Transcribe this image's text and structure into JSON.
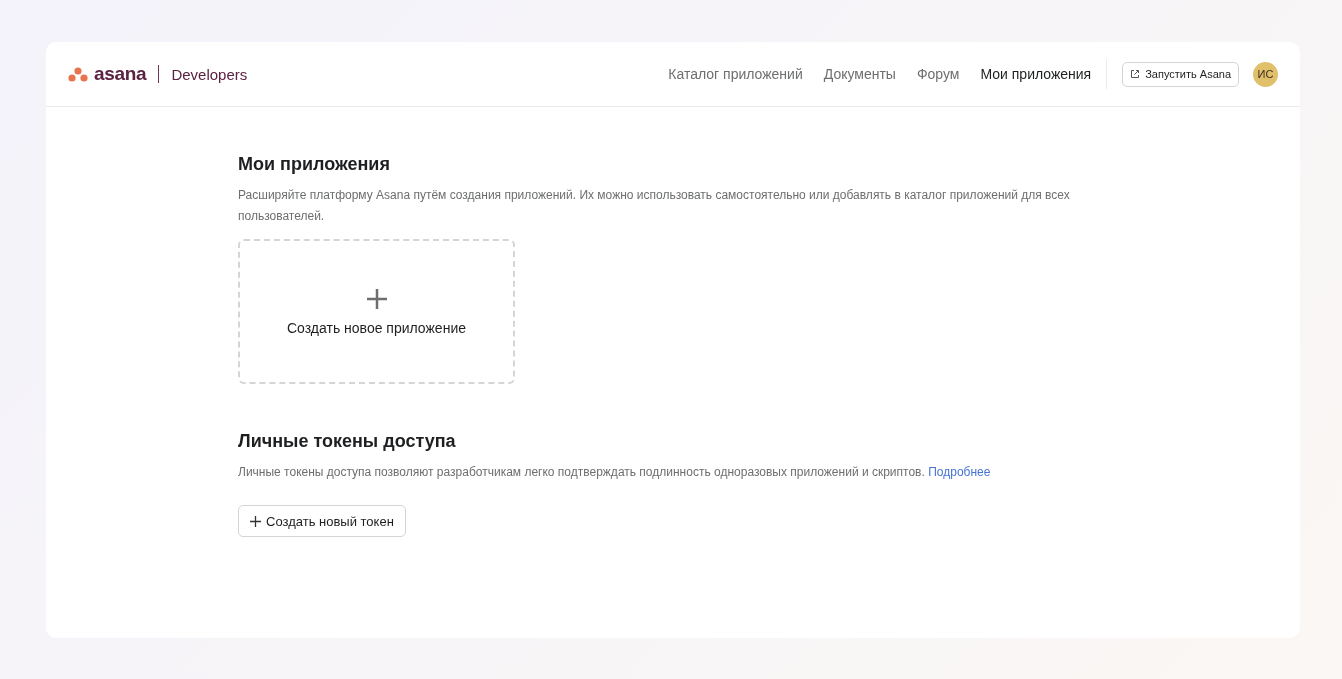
{
  "header": {
    "logo": "asana",
    "product": "Developers",
    "nav": [
      {
        "label": "Каталог приложений",
        "selected": false
      },
      {
        "label": "Документы",
        "selected": false
      },
      {
        "label": "Форум",
        "selected": false
      },
      {
        "label": "Мои приложения",
        "selected": true
      }
    ],
    "launch_button": "Запустить Asana",
    "avatar": "ИС"
  },
  "apps": {
    "title": "Мои приложения",
    "description": "Расширяйте платформу Asana путём создания приложений. Их можно использовать самостоятельно или добавлять в каталог приложений для всех пользователей.",
    "create_card": "Создать новое приложение"
  },
  "tokens": {
    "title": "Личные токены доступа",
    "description": "Личные токены доступа позволяют разработчикам легко подтверждать подлинность одноразовых приложений и скриптов.",
    "link": "Подробнее",
    "create_button": "Создать новый токен"
  }
}
